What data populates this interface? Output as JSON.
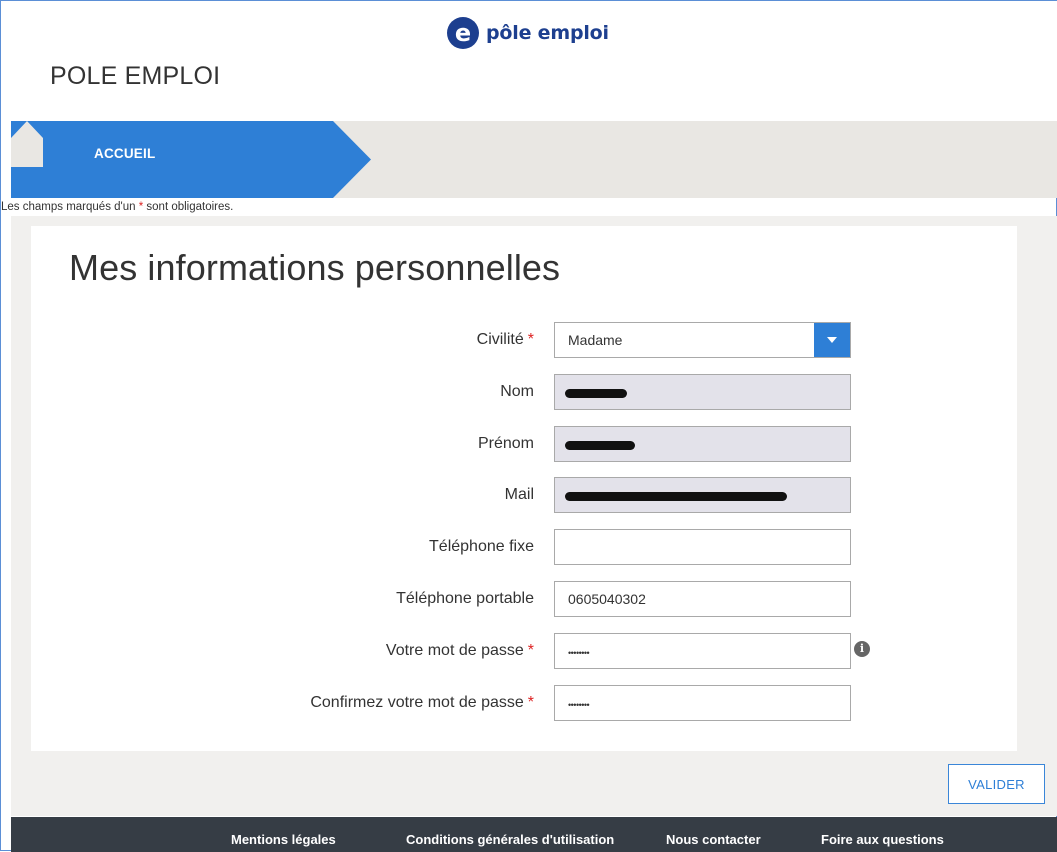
{
  "header": {
    "logo_text": "pôle emploi",
    "app_title": "POLE EMPLOI"
  },
  "breadcrumb": {
    "home_label": "ACCUEIL"
  },
  "notice": {
    "prefix": "Les champs marqués d'un ",
    "star": "*",
    "suffix": " sont obligatoires."
  },
  "form": {
    "title": "Mes informations personnelles",
    "required_marker": "*",
    "civility": {
      "label": "Civilité",
      "value": "Madame",
      "required": true
    },
    "lastname": {
      "label": "Nom",
      "value": "",
      "redacted": true
    },
    "firstname": {
      "label": "Prénom",
      "value": "",
      "redacted": true
    },
    "mail": {
      "label": "Mail",
      "value": "",
      "redacted": true
    },
    "landline": {
      "label": "Téléphone fixe",
      "value": ""
    },
    "mobile": {
      "label": "Téléphone portable",
      "value": "0605040302"
    },
    "password": {
      "label": "Votre mot de passe",
      "value": "••••••••",
      "required": true
    },
    "password_confirm": {
      "label": "Confirmez votre mot de passe",
      "value": "••••••••",
      "required": true
    },
    "info_icon_glyph": "i",
    "submit_label": "VALIDER"
  },
  "footer": {
    "links": [
      "Mentions légales",
      "Conditions générales d'utilisation",
      "Nous contacter",
      "Foire aux questions"
    ]
  },
  "colors": {
    "brand_blue": "#2e7fd6",
    "logo_blue": "#1d3f8f",
    "readonly_bg": "#e3e2ea",
    "footer_bg": "#363d45",
    "required_red": "#dd2222"
  }
}
